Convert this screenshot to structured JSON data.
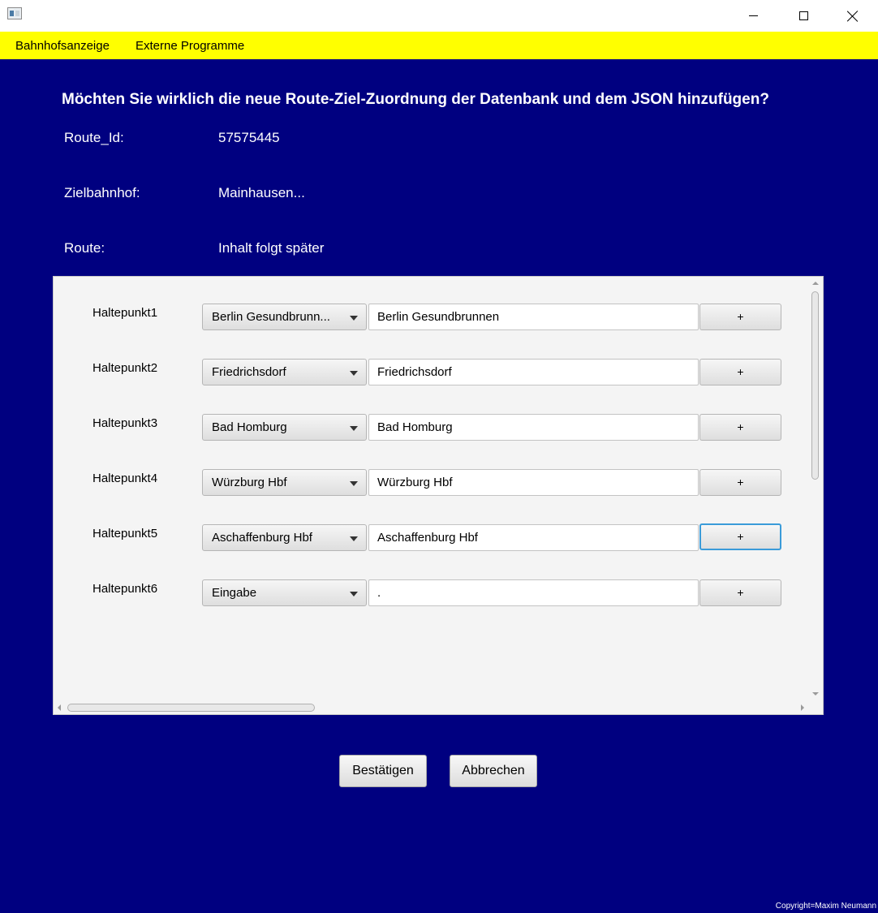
{
  "window": {
    "minimize_icon": "minimize-icon",
    "maximize_icon": "maximize-icon",
    "close_icon": "close-icon"
  },
  "menu": {
    "items": [
      {
        "label": "Bahnhofsanzeige"
      },
      {
        "label": "Externe Programme"
      }
    ]
  },
  "header": {
    "question": "Möchten Sie wirklich die neue Route-Ziel-Zuordnung der Datenbank und dem JSON hinzufügen?",
    "route_id_label": "Route_Id:",
    "route_id_value": "57575445",
    "ziel_label": "Zielbahnhof:",
    "ziel_value": "Mainhausen...",
    "route_label": "Route:",
    "route_value": "Inhalt folgt später"
  },
  "stops": [
    {
      "label": "Haltepunkt1",
      "selected": "Berlin Gesundbrunn...",
      "text": "Berlin Gesundbrunnen",
      "add": "+"
    },
    {
      "label": "Haltepunkt2",
      "selected": "Friedrichsdorf",
      "text": "Friedrichsdorf",
      "add": "+"
    },
    {
      "label": "Haltepunkt3",
      "selected": "Bad Homburg",
      "text": "Bad Homburg",
      "add": "+"
    },
    {
      "label": "Haltepunkt4",
      "selected": "Würzburg Hbf",
      "text": "Würzburg Hbf",
      "add": "+"
    },
    {
      "label": "Haltepunkt5",
      "selected": "Aschaffenburg Hbf",
      "text": "Aschaffenburg Hbf",
      "add": "+"
    },
    {
      "label": "Haltepunkt6",
      "selected": "Eingabe",
      "text": ".",
      "add": "+"
    }
  ],
  "actions": {
    "confirm": "Bestätigen",
    "cancel": "Abbrechen"
  },
  "footer": {
    "copyright": "Copyright=Maxim Neumann"
  },
  "colors": {
    "background": "#000080",
    "menubar": "#ffff00",
    "focus_border": "#3a9bd9"
  }
}
